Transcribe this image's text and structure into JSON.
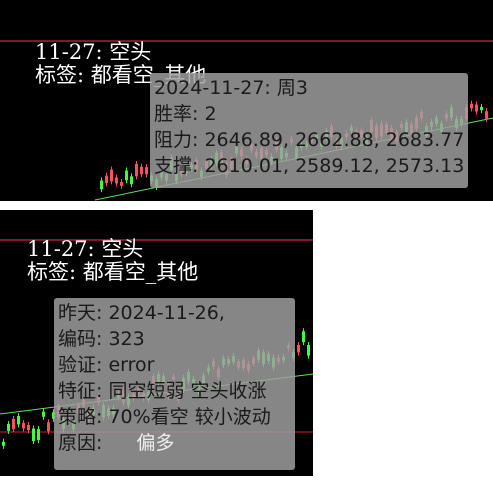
{
  "top": {
    "header": {
      "line1": "11-27: 空头",
      "line2": "标签: 都看空_其他"
    },
    "tooltip": {
      "date_line": "2024-11-27: 周3",
      "win_rate": "胜率: 2",
      "resistance": "阻力: 2646.89, 2662.88, 2683.77",
      "support": "支撑: 2610.01, 2589.12, 2573.13"
    }
  },
  "bottom": {
    "header": {
      "line1": "11-27: 空头",
      "line2": "标签: 都看空_其他"
    },
    "tooltip": {
      "yesterday": "昨天: 2024-11-26,",
      "code": "编码: 323",
      "verify": "验证: error",
      "feature": "特征: 同空短弱 空头收涨",
      "strategy": "策略: 70%看空 较小波动",
      "reason_label": "原因:",
      "reason_extra": "偏多"
    }
  },
  "colors": {
    "background": "#000000",
    "tooltip_bg": "#a0a0a0",
    "candle_up": "#ff5060",
    "candle_down": "#40ff40",
    "ref_line": "#ff3050"
  }
}
